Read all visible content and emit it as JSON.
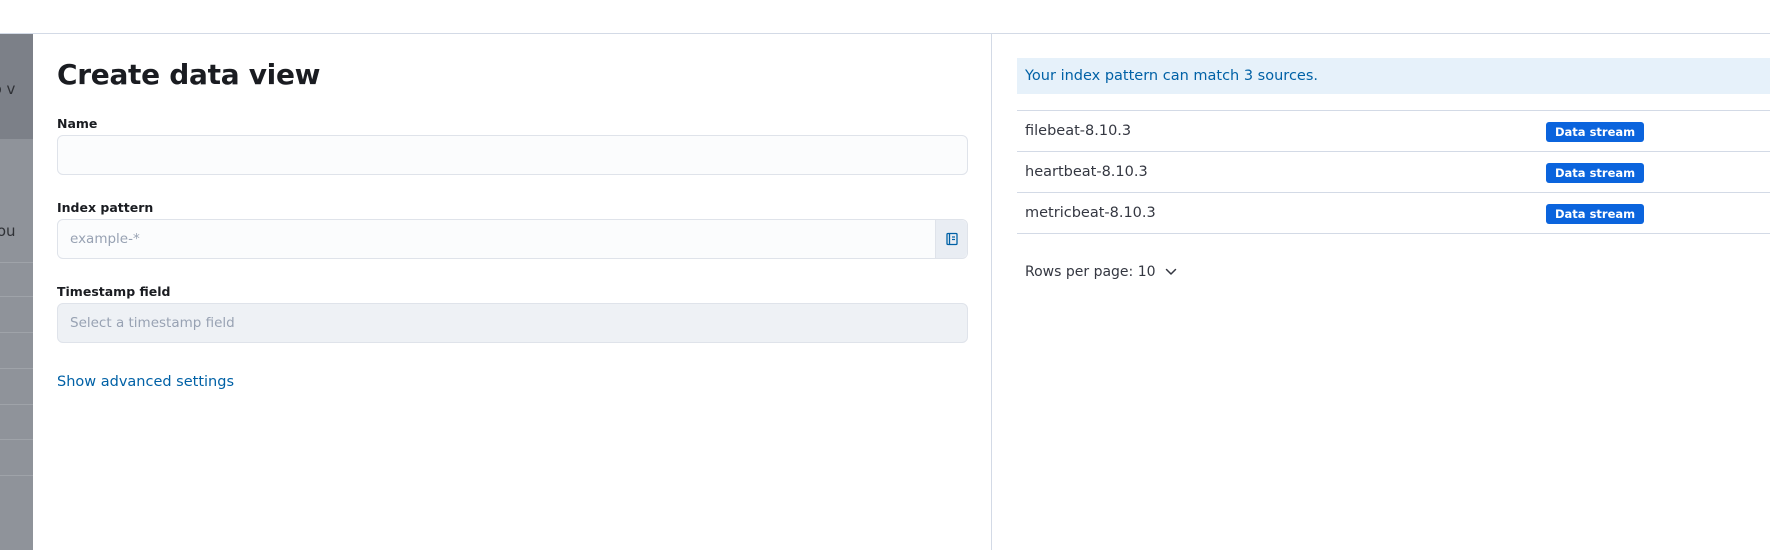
{
  "background": {
    "snippets": [
      "e, so v",
      "e you"
    ]
  },
  "flyout": {
    "title": "Create data view",
    "name_field": {
      "label": "Name",
      "value": "",
      "placeholder": ""
    },
    "index_pattern_field": {
      "label": "Index pattern",
      "value": "",
      "placeholder": "example-*",
      "append_icon": "index-help-icon"
    },
    "timestamp_field": {
      "label": "Timestamp field",
      "placeholder": "Select a timestamp field"
    },
    "advanced_link": "Show advanced settings"
  },
  "sources": {
    "callout": "Your index pattern can match 3 sources.",
    "rows": [
      {
        "name": "filebeat-8.10.3",
        "type": "Data stream"
      },
      {
        "name": "heartbeat-8.10.3",
        "type": "Data stream"
      },
      {
        "name": "metricbeat-8.10.3",
        "type": "Data stream"
      }
    ],
    "pagination": {
      "label": "Rows per page: 10",
      "icon": "chevron-down-icon"
    }
  },
  "colors": {
    "accent_link": "#0061a6",
    "badge": "#0b64dd",
    "callout_bg": "#e6f1fa"
  }
}
